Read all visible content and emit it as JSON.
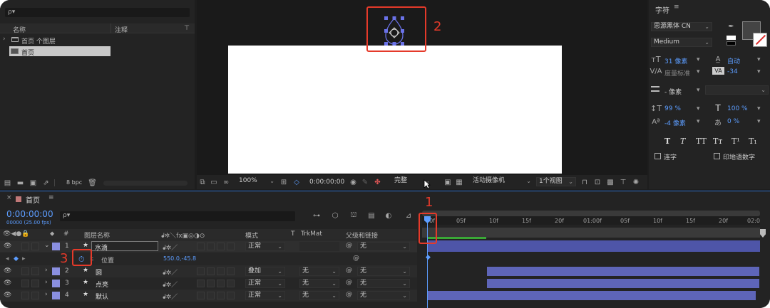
{
  "project": {
    "search_placeholder": "ρ▾",
    "col_name": "名称",
    "col_comment": "注释",
    "item1": "首页 个图层",
    "item2": "首页",
    "bpc": "8 bpc"
  },
  "viewer": {
    "zoom": "100%",
    "timecode": "0:00:00:00",
    "quality": "完整",
    "camera": "活动摄像机",
    "views": "1个视图"
  },
  "character": {
    "title": "字符",
    "font": "思源黑体 CN",
    "style": "Medium",
    "size": "31 像素",
    "leading": "自动",
    "kerning": "度量标准",
    "tracking": "-34",
    "stroke": "- 像素",
    "vscale": "99 %",
    "hscale": "100 %",
    "baseline": "-4 像素",
    "tsume": "0 %",
    "glyphs": [
      "T",
      "T",
      "TT",
      "Tт",
      "T¹",
      "T₁"
    ],
    "ligatures": "连字",
    "hindi": "印地语数字"
  },
  "timeline": {
    "comp_tab": "首页",
    "timecode": "0:00:00:00",
    "fps": "00000 (25.00 fps)",
    "search_placeholder": "ρ▾",
    "col_layer_name": "图层名称",
    "col_mode": "模式",
    "col_t": "T",
    "col_trkmat": "TrkMat",
    "col_parent": "父级和链接",
    "ruler": [
      "00f",
      "05f",
      "10f",
      "15f",
      "20f",
      "01:00f",
      "05f",
      "10f",
      "15f",
      "20f",
      "02:0"
    ],
    "layers": [
      {
        "num": "1",
        "name": "水滴",
        "mode": "正常",
        "trkmat": "",
        "parent": "无"
      },
      {
        "num": "2",
        "name": "圆",
        "mode": "叠加",
        "trkmat": "无",
        "parent": "无"
      },
      {
        "num": "3",
        "name": "点亮",
        "mode": "正常",
        "trkmat": "无",
        "parent": "无"
      },
      {
        "num": "4",
        "name": "默认",
        "mode": "正常",
        "trkmat": "无",
        "parent": "无"
      }
    ],
    "position_label": "位置",
    "position_value": "550.0,-45.8"
  },
  "annotations": {
    "a1": "1",
    "a2": "2",
    "a3": "3"
  },
  "colors": {
    "accent": "#5c9dff",
    "annotation": "#e53a2a",
    "label": "#8a8fe0",
    "bar": "#5e65b8"
  }
}
